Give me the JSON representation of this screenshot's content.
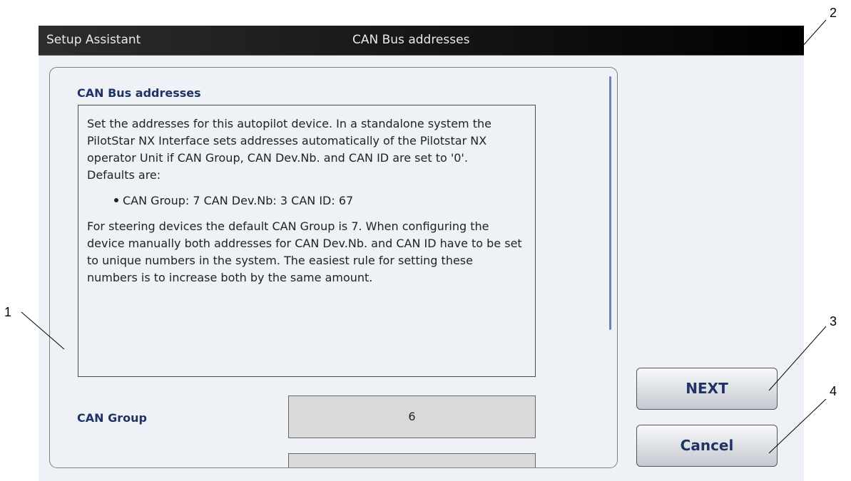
{
  "titlebar": {
    "app_name": "Setup Assistant",
    "page_title": "CAN Bus addresses"
  },
  "panel": {
    "section_title": "CAN Bus addresses",
    "info": {
      "paragraph1": "Set the addresses for this autopilot device. In a standalone system the PilotStar NX Interface sets addresses automatically of the Pilotstar NX operator Unit if CAN Group, CAN Dev.Nb. and CAN ID are set to '0'.",
      "defaults_label": "Defaults are:",
      "bullet": "CAN Group: 7 CAN Dev.Nb: 3 CAN ID: 67",
      "paragraph2": "For steering devices the default CAN Group is 7. When configuring the device manually both addresses for CAN Dev.Nb. and CAN ID have to be set to unique numbers in the system. The easiest rule for setting these numbers is to increase both by the same amount."
    },
    "fields": [
      {
        "label": "CAN Group",
        "value": "6"
      }
    ]
  },
  "buttons": {
    "next": "NEXT",
    "cancel": "Cancel"
  },
  "callouts": [
    "1",
    "2",
    "3",
    "4"
  ]
}
